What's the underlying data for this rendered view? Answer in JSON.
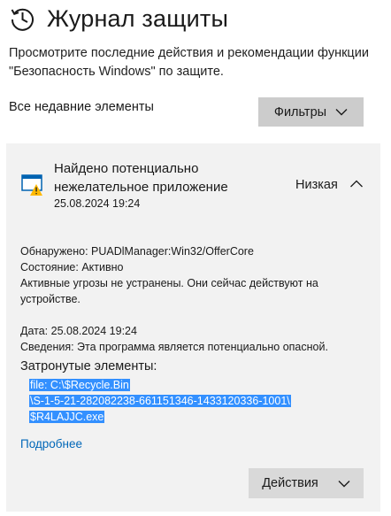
{
  "header": {
    "title": "Журнал защиты",
    "description": "Просмотрите последние действия и рекомендации функции \"Безопасность Windows\" по защите."
  },
  "toolbar": {
    "recent_label": "Все недавние элементы",
    "filters_label": "Фильтры"
  },
  "threat": {
    "title": "Найдено потенциально нежелательное приложение",
    "date": "25.08.2024 19:24",
    "severity": "Низкая",
    "details": {
      "detected": "Обнаружено: PUADlManager:Win32/OfferCore",
      "status": "Состояние:  Активно",
      "message": "Активные угрозы не устранены. Они сейчас действуют на устройстве.",
      "date": "Дата:  25.08.2024 19:24",
      "info": "Сведения:  Эта программа является потенциально опасной."
    },
    "affected_label": "Затронутые элементы:",
    "affected_lines": [
      "file: C:\\$Recycle.Bin",
      "\\S-1-5-21-282082238-661151346-1433120336-1001\\",
      "$R4LAJJC.exe"
    ],
    "more_link": "Подробнее",
    "actions_label": "Действия"
  },
  "icons": {
    "history": "history-clock-icon",
    "threat": "app-warning-icon",
    "collapse": "chevron-up-icon",
    "dropdown": "chevron-down-icon"
  },
  "colors": {
    "link": "#0067b8",
    "selection": "#3390ff",
    "warning": "#ffb900",
    "app_blue": "#0063b1"
  }
}
